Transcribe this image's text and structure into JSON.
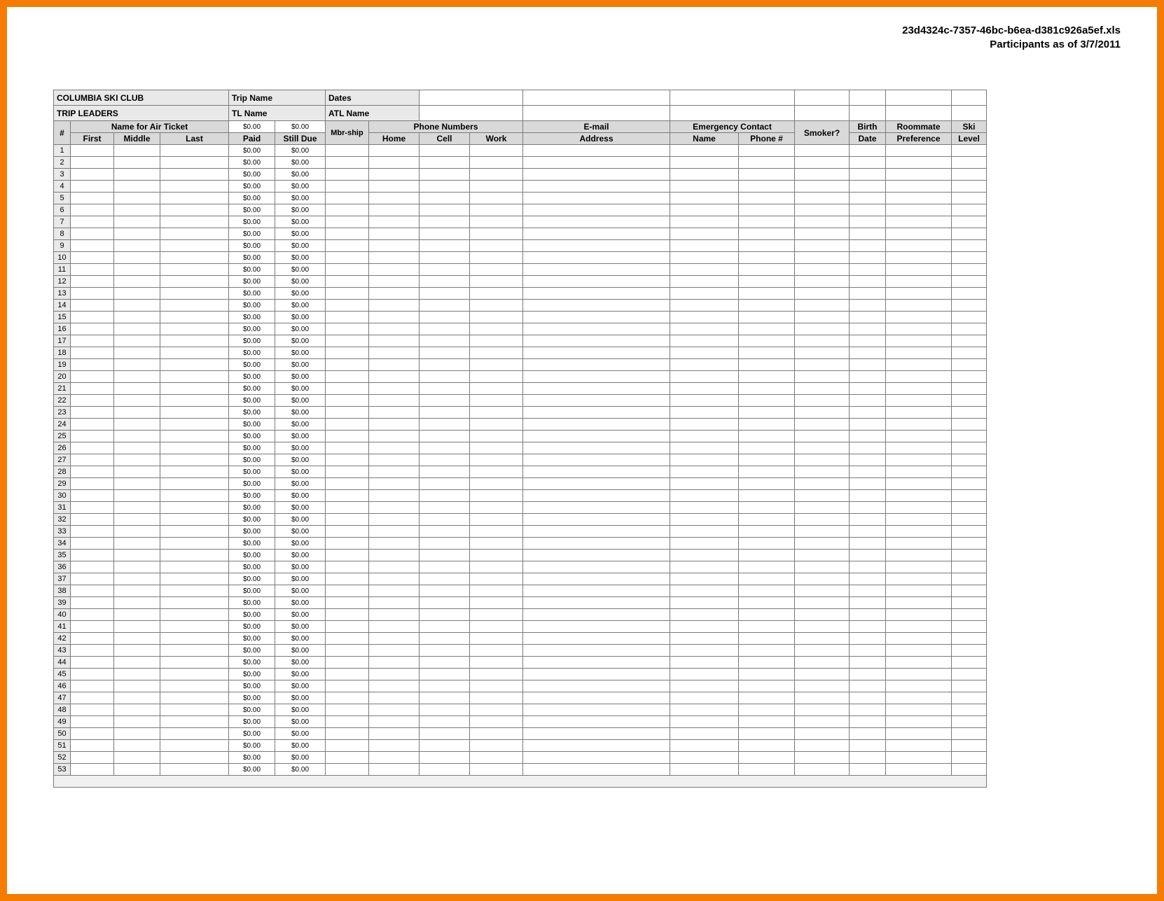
{
  "document": {
    "filename": "23d4324c-7357-46bc-b6ea-d381c926a5ef.xls",
    "subtitle": "Participants as of 3/7/2011"
  },
  "titles": {
    "club": "COLUMBIA SKI CLUB",
    "trip_leaders": "TRIP LEADERS",
    "trip_name": "Trip Name",
    "tl_name": "TL Name",
    "dates": "Dates",
    "atl_name": "ATL Name"
  },
  "headers": {
    "row_no": "#",
    "name_group": "Name for Air Ticket",
    "first": "First",
    "middle": "Middle",
    "last": "Last",
    "paid": "Paid",
    "still_due": "Still Due",
    "mbr_ship": "Mbr-ship",
    "phone_group": "Phone Numbers",
    "home": "Home",
    "cell": "Cell",
    "work": "Work",
    "email_group": "E-mail",
    "address": "Address",
    "emerg_group": "Emergency Contact",
    "emerg_name": "Name",
    "emerg_phone": "Phone #",
    "smoker": "Smoker?",
    "birth": "Birth",
    "birth_sub": "Date",
    "roommate": "Roommate",
    "roommate_sub": "Preference",
    "ski": "Ski",
    "ski_sub": "Level"
  },
  "totals": {
    "paid": "$0.00",
    "still_due": "$0.00"
  },
  "row_count": 53,
  "row": {
    "paid": "$0.00",
    "still_due": "$0.00"
  }
}
